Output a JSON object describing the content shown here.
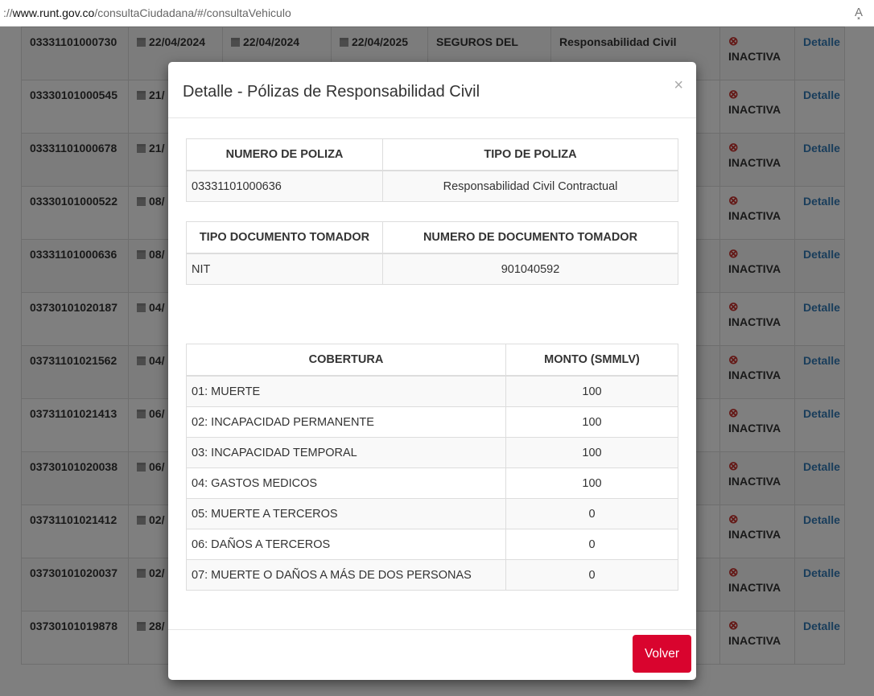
{
  "browser": {
    "url_prefix": "://",
    "url_host": "www.runt.gov.co",
    "url_path": "/consultaCiudadana/#/consultaVehiculo",
    "read_aloud_glyph": "A͓"
  },
  "background_table": {
    "rows": [
      {
        "numero": "03331101000730",
        "fecha1": "22/04/2024",
        "fecha2": "22/04/2024",
        "fecha3": "22/04/2025",
        "entidad": "SEGUROS DEL",
        "tipo": "Responsabilidad Civil",
        "estado": "INACTIVA",
        "accion": "Detalle"
      },
      {
        "numero": "03330101000545",
        "fecha1": "21/",
        "fecha2": "",
        "fecha3": "",
        "entidad": "",
        "tipo": "",
        "estado": "INACTIVA",
        "accion": "Detalle"
      },
      {
        "numero": "03331101000678",
        "fecha1": "21/",
        "fecha2": "",
        "fecha3": "",
        "entidad": "",
        "tipo": "",
        "estado": "INACTIVA",
        "accion": "Detalle"
      },
      {
        "numero": "03330101000522",
        "fecha1": "08/",
        "fecha2": "",
        "fecha3": "",
        "entidad": "",
        "tipo": "",
        "estado": "INACTIVA",
        "accion": "Detalle"
      },
      {
        "numero": "03331101000636",
        "fecha1": "08/",
        "fecha2": "",
        "fecha3": "",
        "entidad": "",
        "tipo": "",
        "estado": "INACTIVA",
        "accion": "Detalle"
      },
      {
        "numero": "03730101020187",
        "fecha1": "04/",
        "fecha2": "",
        "fecha3": "",
        "entidad": "",
        "tipo": "",
        "estado": "INACTIVA",
        "accion": "Detalle"
      },
      {
        "numero": "03731101021562",
        "fecha1": "04/",
        "fecha2": "",
        "fecha3": "",
        "entidad": "",
        "tipo": "",
        "estado": "INACTIVA",
        "accion": "Detalle"
      },
      {
        "numero": "03731101021413",
        "fecha1": "06/",
        "fecha2": "",
        "fecha3": "",
        "entidad": "",
        "tipo": "",
        "estado": "INACTIVA",
        "accion": "Detalle"
      },
      {
        "numero": "03730101020038",
        "fecha1": "06/",
        "fecha2": "",
        "fecha3": "",
        "entidad": "",
        "tipo": "",
        "estado": "INACTIVA",
        "accion": "Detalle"
      },
      {
        "numero": "03731101021412",
        "fecha1": "02/",
        "fecha2": "",
        "fecha3": "",
        "entidad": "",
        "tipo": "",
        "estado": "INACTIVA",
        "accion": "Detalle"
      },
      {
        "numero": "03730101020037",
        "fecha1": "02/",
        "fecha2": "",
        "fecha3": "",
        "entidad": "",
        "tipo": "",
        "estado": "INACTIVA",
        "accion": "Detalle"
      },
      {
        "numero": "03730101019878",
        "fecha1": "28/",
        "fecha2": "",
        "fecha3": "",
        "entidad": "",
        "tipo": "",
        "estado": "INACTIVA",
        "accion": "Detalle"
      }
    ]
  },
  "modal": {
    "title": "Detalle - Pólizas de Responsabilidad Civil",
    "close_glyph": "×",
    "poliza": {
      "headers": [
        "NUMERO DE POLIZA",
        "TIPO DE POLIZA"
      ],
      "row": [
        "03331101000636",
        "Responsabilidad Civil Contractual"
      ]
    },
    "tomador": {
      "headers": [
        "TIPO DOCUMENTO TOMADOR",
        "NUMERO DE DOCUMENTO TOMADOR"
      ],
      "row": [
        "NIT",
        "901040592"
      ]
    },
    "coberturas": {
      "headers": [
        "COBERTURA",
        "MONTO (SMMLV)"
      ],
      "rows": [
        [
          "01: MUERTE",
          "100"
        ],
        [
          "02: INCAPACIDAD PERMANENTE",
          "100"
        ],
        [
          "03: INCAPACIDAD TEMPORAL",
          "100"
        ],
        [
          "04: GASTOS MEDICOS",
          "100"
        ],
        [
          "05: MUERTE A TERCEROS",
          "0"
        ],
        [
          "06: DAÑOS A TERCEROS",
          "0"
        ],
        [
          "07: MUERTE O DAÑOS A MÁS DE DOS PERSONAS",
          "0"
        ]
      ]
    },
    "volver_label": "Volver"
  },
  "colors": {
    "accent": "#d9042e",
    "link": "#337ab7",
    "inactive": "#c9302c"
  }
}
